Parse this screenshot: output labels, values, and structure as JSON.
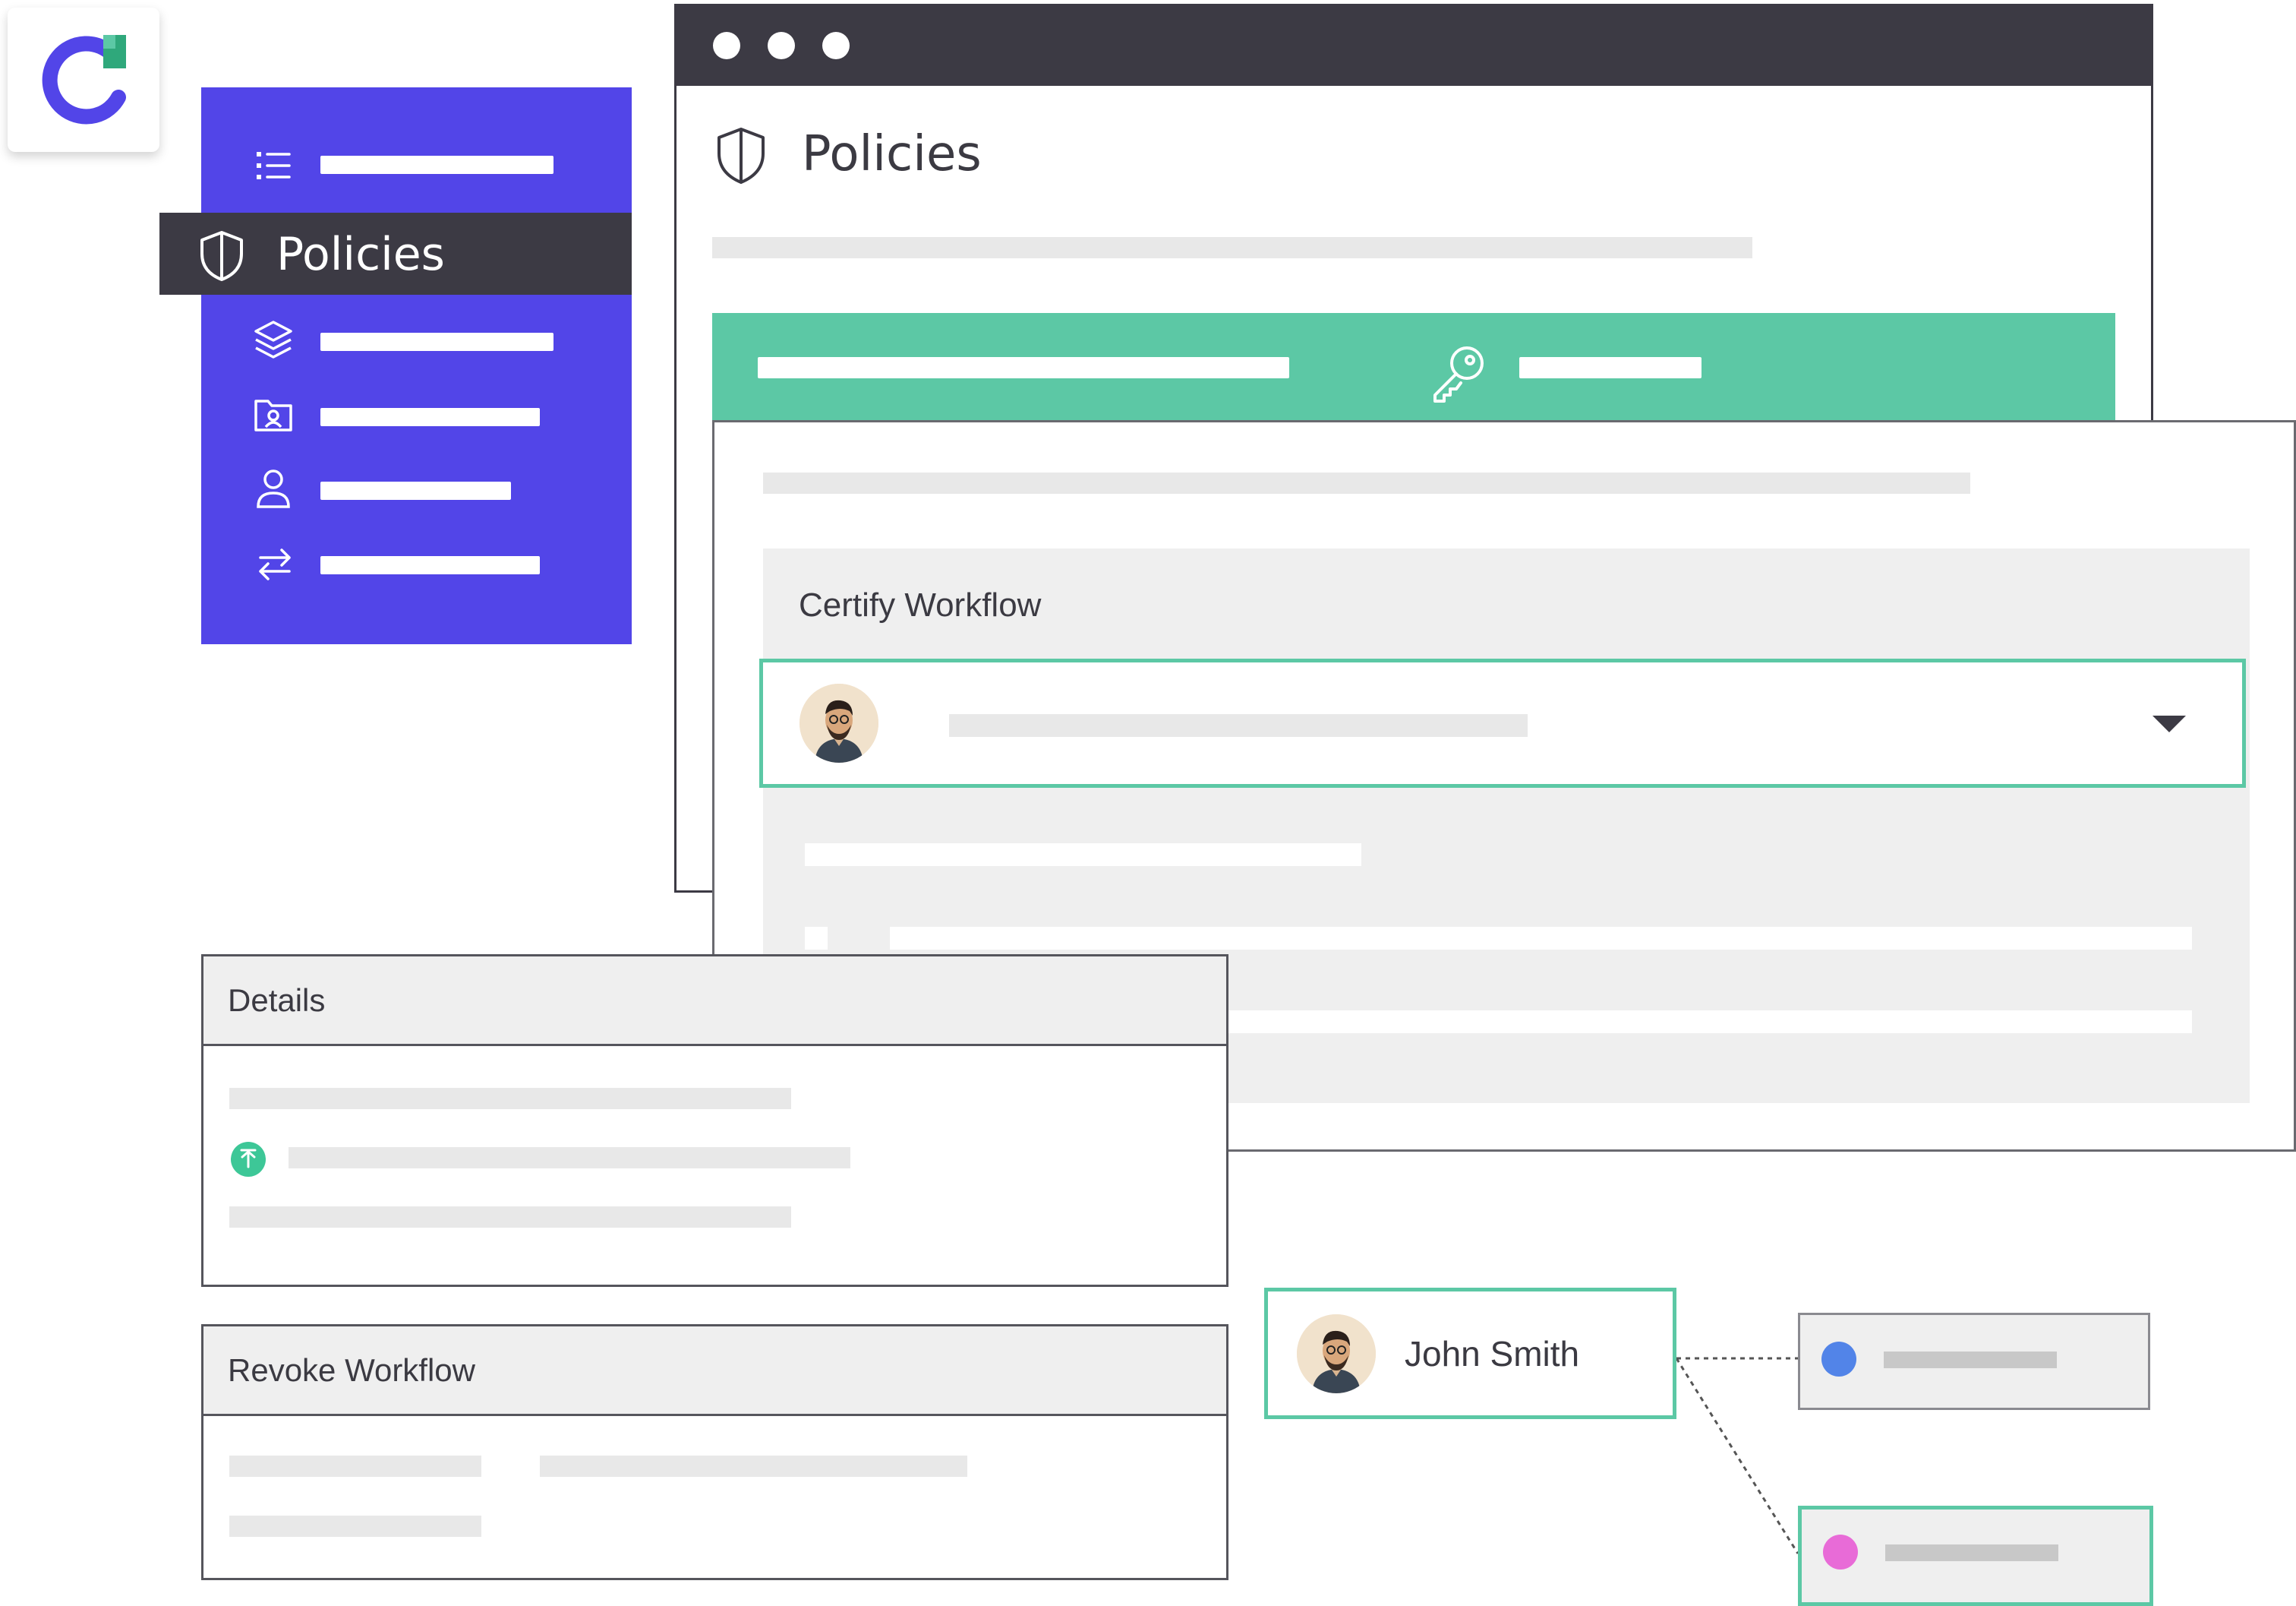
{
  "sidebar": {
    "active_label": "Policies",
    "accent": "#5245e8",
    "active_bg": "#3c3a44",
    "items": [
      {
        "icon": "list-icon"
      },
      {
        "icon": "shield-icon",
        "label": "Policies"
      },
      {
        "icon": "layers-icon"
      },
      {
        "icon": "folder-user-icon"
      },
      {
        "icon": "user-icon"
      },
      {
        "icon": "swap-arrows-icon"
      }
    ]
  },
  "browser": {
    "title": "Policies",
    "titlebar_color": "#3c3a44",
    "banner_color": "#5cc8a5",
    "banner_icon": "key-icon"
  },
  "certify": {
    "title": "Certify Workflow",
    "select_icon": "caret-down-icon"
  },
  "details": {
    "title": "Details",
    "status_icon": "arrow-up-circle-icon"
  },
  "revoke": {
    "title": "Revoke Workflow"
  },
  "user": {
    "name": "John Smith",
    "nodes": [
      {
        "color": "#5284e8"
      },
      {
        "color": "#e86bd7"
      }
    ]
  }
}
